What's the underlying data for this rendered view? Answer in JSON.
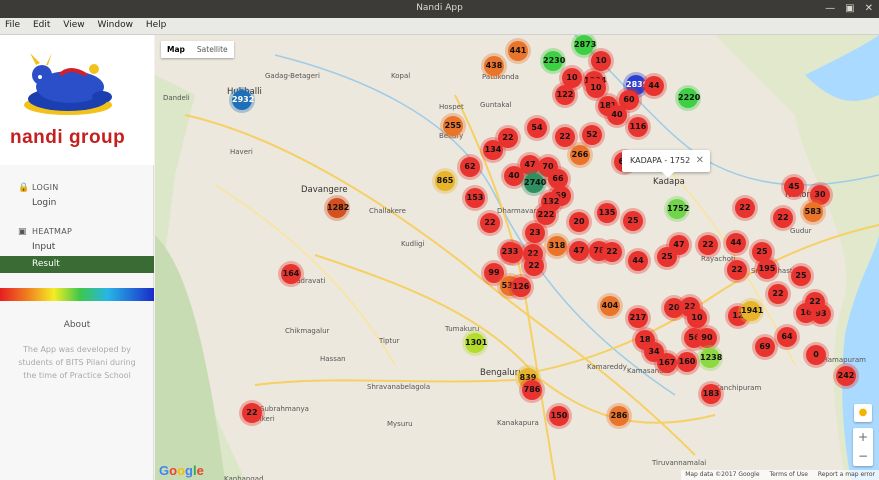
{
  "window": {
    "title": "Nandi App",
    "minimize_icon": "minimize-icon",
    "maximize_icon": "maximize-icon",
    "close_icon": "close-icon"
  },
  "menu": [
    "File",
    "Edit",
    "View",
    "Window",
    "Help"
  ],
  "logo": {
    "text_left": "nandi",
    "text_right": "group"
  },
  "nav": {
    "login": {
      "header": "LOGIN",
      "icon": "lock-icon",
      "items": [
        "Login"
      ]
    },
    "heatmap": {
      "header": "HEATMAP",
      "icon": "map-icon",
      "items": [
        "Input",
        "Result"
      ],
      "active": "Result"
    }
  },
  "about": {
    "title": "About",
    "text": "The App was developed by students of BITS Pilani during the time of Practice School"
  },
  "map": {
    "type_buttons": [
      "Map",
      "Satellite"
    ],
    "selected_type": "Map",
    "popup": "KADAPA - 1752",
    "zoom_in": "+",
    "zoom_out": "−",
    "google": "Google",
    "footer": [
      "Map data ©2017 Google",
      "Terms of Use",
      "Report a map error"
    ],
    "places": [
      {
        "name": "Hubballi"
      },
      {
        "name": "Gadag-Betageri"
      },
      {
        "name": "Kopal"
      },
      {
        "name": "Hospet"
      },
      {
        "name": "Dandeli"
      },
      {
        "name": "Haveri"
      },
      {
        "name": "Davangere"
      },
      {
        "name": "Challakere"
      },
      {
        "name": "Bhadravati"
      },
      {
        "name": "Chikmagalur"
      },
      {
        "name": "Tiptur"
      },
      {
        "name": "Tumakuru"
      },
      {
        "name": "Hassan"
      },
      {
        "name": "Shravanabelagola"
      },
      {
        "name": "Bengaluru"
      },
      {
        "name": "Madikeri"
      },
      {
        "name": "Mysuru"
      },
      {
        "name": "Kanakapura"
      },
      {
        "name": "Kanchipuram"
      },
      {
        "name": "Tiruvannamalai"
      },
      {
        "name": "Kamareddy"
      },
      {
        "name": "Pattikonda"
      },
      {
        "name": "Guntakal"
      },
      {
        "name": "Bellary"
      },
      {
        "name": "Dharmavaram"
      },
      {
        "name": "Kadapa"
      },
      {
        "name": "Nellore"
      },
      {
        "name": "Gudur"
      },
      {
        "name": "Sri Kalahasti"
      },
      {
        "name": "Ramapuram"
      },
      {
        "name": "Kamasandra"
      },
      {
        "name": "Kanhangad"
      },
      {
        "name": "Subrahmanya"
      },
      {
        "name": "Kudligi"
      },
      {
        "name": "Rayachoti"
      }
    ],
    "markers": [
      {
        "label": "2932",
        "color": "#1f6fb8"
      },
      {
        "label": "441",
        "color": "#e9742a"
      },
      {
        "label": "438",
        "color": "#e9742a"
      },
      {
        "label": "2230",
        "color": "#3ed043"
      },
      {
        "label": "2873",
        "color": "#3ed043"
      },
      {
        "label": "10",
        "color": "#e8332f"
      },
      {
        "label": "10",
        "color": "#e8332f"
      },
      {
        "label": "1334",
        "color": "#e8332f"
      },
      {
        "label": "2839",
        "color": "#2a3fcf"
      },
      {
        "label": "44",
        "color": "#e8332f"
      },
      {
        "label": "10",
        "color": "#e8332f"
      },
      {
        "label": "122",
        "color": "#e8332f"
      },
      {
        "label": "181",
        "color": "#e8332f"
      },
      {
        "label": "60",
        "color": "#e8332f"
      },
      {
        "label": "2220",
        "color": "#3ed043"
      },
      {
        "label": "40",
        "color": "#e8332f"
      },
      {
        "label": "255",
        "color": "#e9742a"
      },
      {
        "label": "116",
        "color": "#e8332f"
      },
      {
        "label": "54",
        "color": "#e8332f"
      },
      {
        "label": "22",
        "color": "#e8332f"
      },
      {
        "label": "22",
        "color": "#e8332f"
      },
      {
        "label": "52",
        "color": "#e8332f"
      },
      {
        "label": "134",
        "color": "#e8332f"
      },
      {
        "label": "266",
        "color": "#e9742a"
      },
      {
        "label": "62",
        "color": "#e8332f"
      },
      {
        "label": "47",
        "color": "#e8332f"
      },
      {
        "label": "70",
        "color": "#e8332f"
      },
      {
        "label": "64",
        "color": "#e8332f"
      },
      {
        "label": "40",
        "color": "#e8332f"
      },
      {
        "label": "2740",
        "color": "#2e8f61"
      },
      {
        "label": "66",
        "color": "#e8332f"
      },
      {
        "label": "865",
        "color": "#e8b52a"
      },
      {
        "label": "153",
        "color": "#e8332f"
      },
      {
        "label": "59",
        "color": "#e8332f"
      },
      {
        "label": "132",
        "color": "#e8332f"
      },
      {
        "label": "1752",
        "color": "#6fd64a"
      },
      {
        "label": "22",
        "color": "#e8332f"
      },
      {
        "label": "45",
        "color": "#e8332f"
      },
      {
        "label": "30",
        "color": "#e8332f"
      },
      {
        "label": "1282",
        "color": "#d4501f"
      },
      {
        "label": "222",
        "color": "#e8332f"
      },
      {
        "label": "135",
        "color": "#e8332f"
      },
      {
        "label": "22",
        "color": "#e8332f"
      },
      {
        "label": "20",
        "color": "#e8332f"
      },
      {
        "label": "25",
        "color": "#e8332f"
      },
      {
        "label": "583",
        "color": "#e9742a"
      },
      {
        "label": "22",
        "color": "#e8332f"
      },
      {
        "label": "23",
        "color": "#e8332f"
      },
      {
        "label": "318",
        "color": "#e9742a"
      },
      {
        "label": "47",
        "color": "#e8332f"
      },
      {
        "label": "78",
        "color": "#e8332f"
      },
      {
        "label": "22",
        "color": "#e8332f"
      },
      {
        "label": "47",
        "color": "#e8332f"
      },
      {
        "label": "22",
        "color": "#e8332f"
      },
      {
        "label": "44",
        "color": "#e8332f"
      },
      {
        "label": "22",
        "color": "#e8332f"
      },
      {
        "label": "22",
        "color": "#e8332f"
      },
      {
        "label": "233",
        "color": "#e8332f"
      },
      {
        "label": "22",
        "color": "#e8332f"
      },
      {
        "label": "44",
        "color": "#e8332f"
      },
      {
        "label": "25",
        "color": "#e8332f"
      },
      {
        "label": "25",
        "color": "#e8332f"
      },
      {
        "label": "99",
        "color": "#e8332f"
      },
      {
        "label": "22",
        "color": "#e8332f"
      },
      {
        "label": "195",
        "color": "#e8332f"
      },
      {
        "label": "25",
        "color": "#e8332f"
      },
      {
        "label": "531",
        "color": "#e9742a"
      },
      {
        "label": "164",
        "color": "#e8332f"
      },
      {
        "label": "126",
        "color": "#e8332f"
      },
      {
        "label": "22",
        "color": "#e8332f"
      },
      {
        "label": "404",
        "color": "#e9742a"
      },
      {
        "label": "217",
        "color": "#e8332f"
      },
      {
        "label": "20",
        "color": "#e8332f"
      },
      {
        "label": "22",
        "color": "#e8332f"
      },
      {
        "label": "10",
        "color": "#e8332f"
      },
      {
        "label": "12",
        "color": "#e8332f"
      },
      {
        "label": "1941",
        "color": "#e8b52a"
      },
      {
        "label": "16",
        "color": "#e8332f"
      },
      {
        "label": "93",
        "color": "#e8332f"
      },
      {
        "label": "22",
        "color": "#e8332f"
      },
      {
        "label": "64",
        "color": "#e8332f"
      },
      {
        "label": "1301",
        "color": "#b4dc2c"
      },
      {
        "label": "18",
        "color": "#e8332f"
      },
      {
        "label": "56",
        "color": "#e8332f"
      },
      {
        "label": "90",
        "color": "#e8332f"
      },
      {
        "label": "69",
        "color": "#e8332f"
      },
      {
        "label": "34",
        "color": "#e8332f"
      },
      {
        "label": "167",
        "color": "#e8332f"
      },
      {
        "label": "160",
        "color": "#e8332f"
      },
      {
        "label": "1238",
        "color": "#8ed844"
      },
      {
        "label": "0",
        "color": "#e8332f"
      },
      {
        "label": "839",
        "color": "#e8b52a"
      },
      {
        "label": "786",
        "color": "#e8332f"
      },
      {
        "label": "242",
        "color": "#e8332f"
      },
      {
        "label": "183",
        "color": "#e8332f"
      },
      {
        "label": "150",
        "color": "#e8332f"
      },
      {
        "label": "286",
        "color": "#e9742a"
      },
      {
        "label": "22",
        "color": "#e8332f"
      }
    ]
  }
}
